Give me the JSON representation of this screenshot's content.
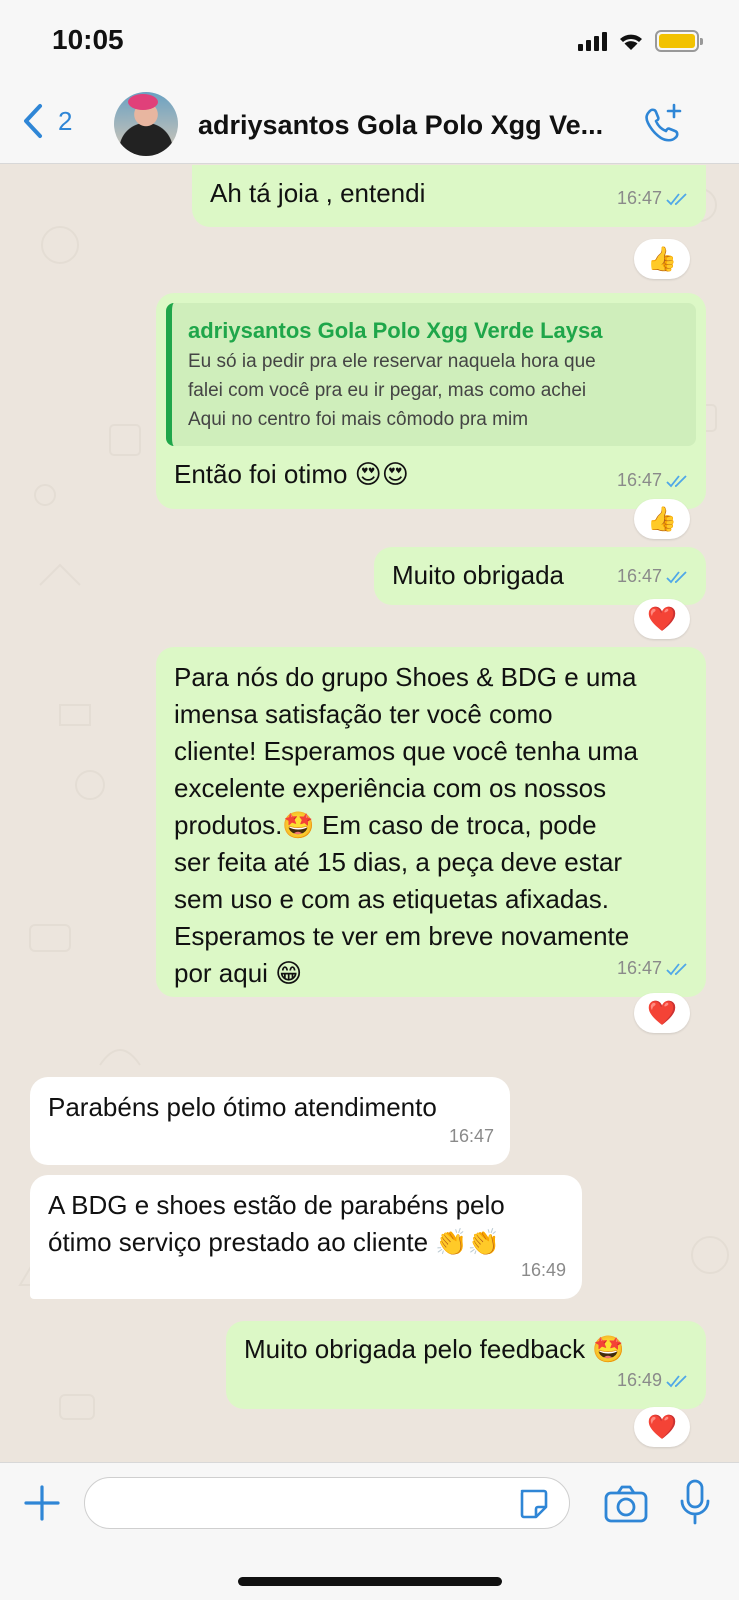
{
  "status": {
    "time": "10:05"
  },
  "header": {
    "back_count": "2",
    "title": "adriysantos Gola Polo Xgg Ve..."
  },
  "messages": [
    {
      "text": "Ah tá joia , entendi",
      "time": "16:47",
      "reaction": "👍"
    },
    {
      "quote_author": "adriysantos Gola Polo Xgg Verde Laysa",
      "quote_line1": "Eu só ia pedir pra ele reservar naquela hora que",
      "quote_line2": "falei com você pra eu ir pegar, mas como achei",
      "quote_line3": "Aqui no centro foi mais cômodo pra mim",
      "text": "Então foi otimo 😍😍",
      "time": "16:47",
      "reaction": "👍"
    },
    {
      "text": "Muito obrigada",
      "time": "16:47",
      "reaction": "❤️"
    },
    {
      "line1": "Para nós do grupo Shoes & BDG e uma",
      "line2": "imensa satisfação ter você como",
      "line3": "cliente! Esperamos que você tenha uma",
      "line4": "excelente experiência com os nossos",
      "line5": "produtos.🤩 Em caso de troca, pode",
      "line6": "ser feita até 15 dias,  a peça deve estar",
      "line7": "sem uso e com as etiquetas afixadas.",
      "line8": "Esperamos te ver em breve novamente",
      "line9": "por aqui 😁",
      "time": "16:47",
      "reaction": "❤️"
    },
    {
      "text": "Parabéns pelo ótimo atendimento",
      "time": "16:47"
    },
    {
      "line1": "A BDG e shoes estão de parabéns pelo",
      "line2": "ótimo serviço prestado ao cliente 👏👏",
      "time": "16:49"
    },
    {
      "text": "Muito obrigada pelo feedback 🤩",
      "time": "16:49",
      "reaction": "❤️"
    }
  ],
  "colors": {
    "outgoing": "#dcf8c6",
    "incoming": "#ffffff",
    "accent": "#2f86d6",
    "quote_green": "#1fa64a"
  },
  "icons": [
    "back-chevron-icon",
    "add-call-icon",
    "plus-icon",
    "sticker-icon",
    "camera-icon",
    "mic-icon"
  ]
}
